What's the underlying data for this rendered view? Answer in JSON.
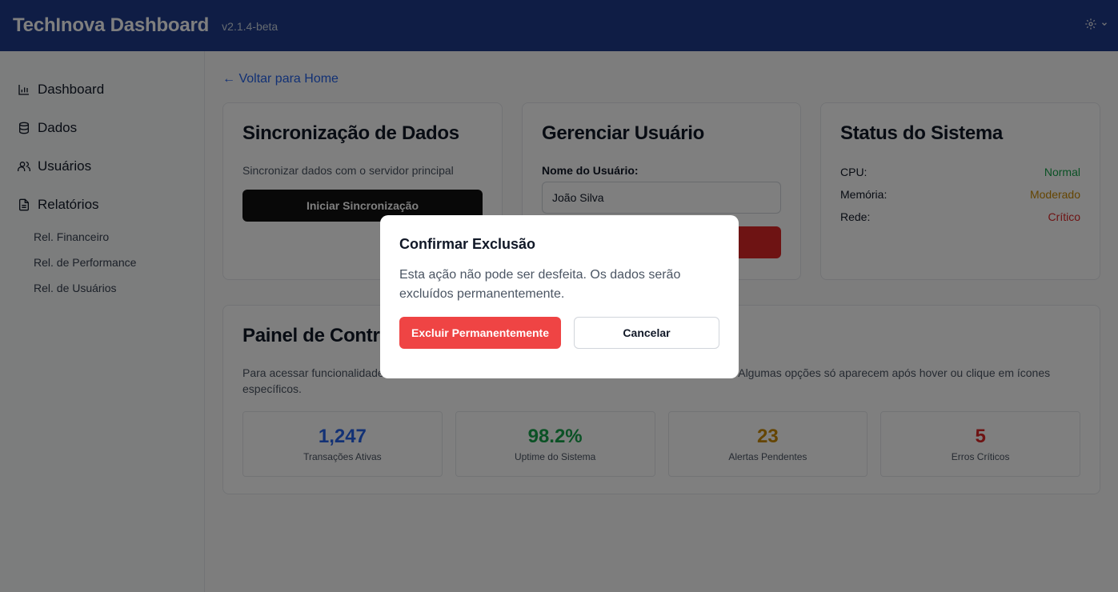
{
  "header": {
    "title": "TechInova Dashboard",
    "version": "v2.1.4-beta",
    "settings_icon": "gear-icon",
    "color": "#1e3a8a"
  },
  "sidebar": {
    "items": [
      {
        "label": "Dashboard",
        "icon": "bar-chart-icon"
      },
      {
        "label": "Dados",
        "icon": "database-icon"
      },
      {
        "label": "Usuários",
        "icon": "users-icon"
      },
      {
        "label": "Relatórios",
        "icon": "file-text-icon"
      }
    ],
    "sub_items": [
      "Rel. Financeiro",
      "Rel. de Performance",
      "Rel. de Usuários"
    ]
  },
  "main": {
    "back_link": "← Voltar para Home",
    "sync_card": {
      "title": "Sincronização de Dados",
      "description": "Sincronizar dados com o servidor principal",
      "button": "Iniciar Sincronização"
    },
    "user_card": {
      "title": "Gerenciar Usuário",
      "field_label": "Nome do Usuário:",
      "field_value": "João Silva"
    },
    "status_card": {
      "title": "Status do Sistema",
      "rows": [
        {
          "label": "CPU:",
          "value": "Normal",
          "color": "#16a34a"
        },
        {
          "label": "Memória:",
          "value": "Moderado",
          "color": "#ca8a04"
        },
        {
          "label": "Rede:",
          "value": "Crítico",
          "color": "#dc2626"
        }
      ]
    },
    "control_panel": {
      "title": "Painel de Contro",
      "description_left": "Para acessar funcionalidade",
      "description_right": "ral. Algumas opções só aparecem após hover ou clique em ícones",
      "description_line2": "específicos.",
      "stats": [
        {
          "value": "1,247",
          "label": "Transações Ativas",
          "color": "#2563eb"
        },
        {
          "value": "98.2%",
          "label": "Uptime do Sistema",
          "color": "#16a34a"
        },
        {
          "value": "23",
          "label": "Alertas Pendentes",
          "color": "#ca8a04"
        },
        {
          "value": "5",
          "label": "Erros Críticos",
          "color": "#dc2626"
        }
      ]
    }
  },
  "modal": {
    "title": "Confirmar Exclusão",
    "text": "Esta ação não pode ser desfeita. Os dados serão excluídos permanentemente.",
    "confirm_button": "Excluir Permanentemente",
    "cancel_button": "Cancelar"
  }
}
